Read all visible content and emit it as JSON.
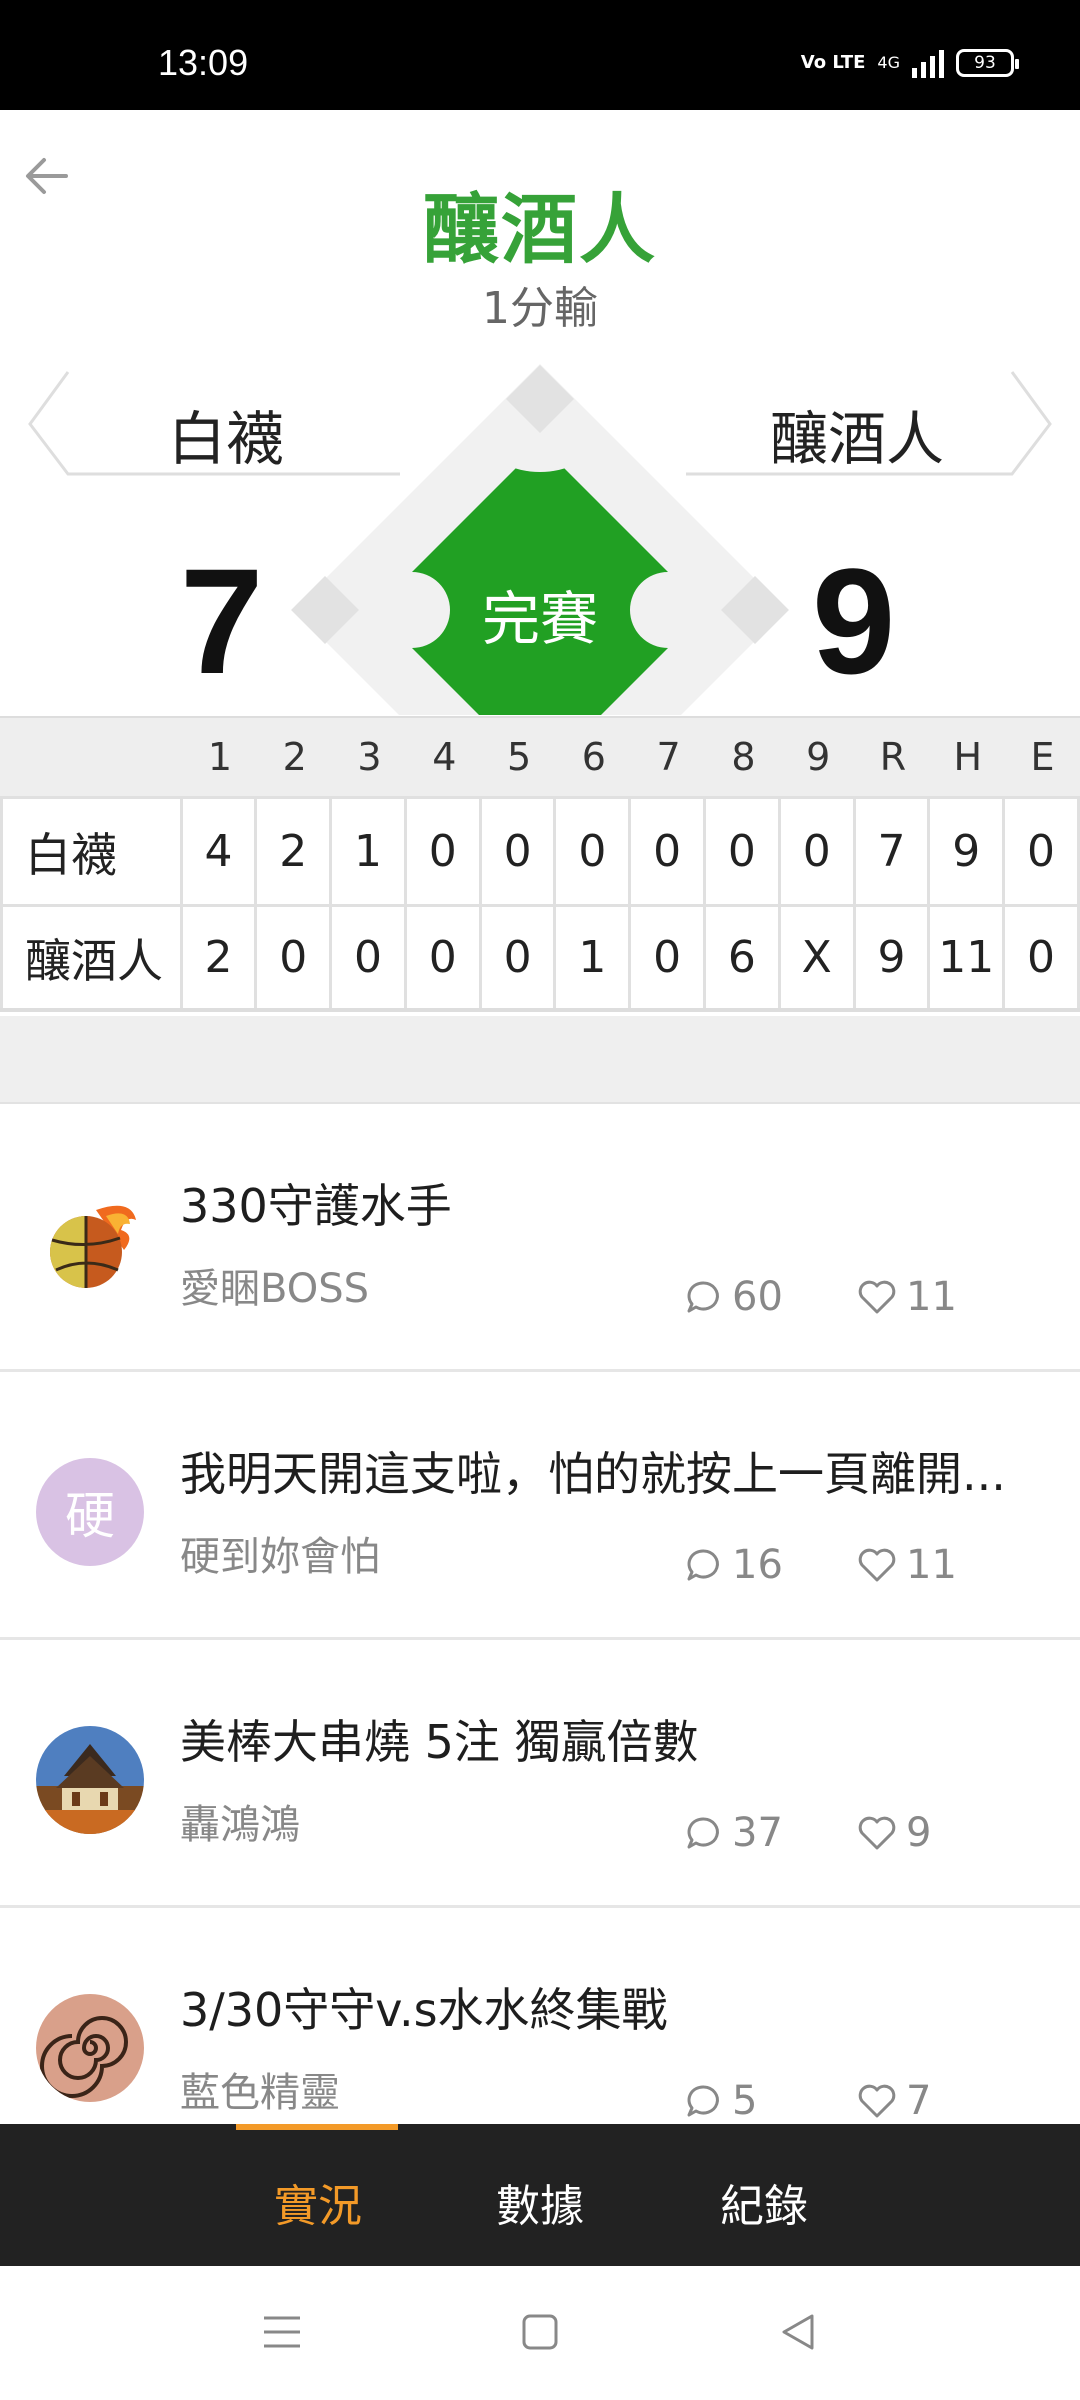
{
  "status_bar": {
    "time": "13:09",
    "network": "4G",
    "volte": "Vo LTE",
    "battery": "93"
  },
  "header": {
    "title": "釀酒人",
    "result": "1分輸"
  },
  "matchup": {
    "away_team": "白襪",
    "home_team": "釀酒人",
    "away_score": "7",
    "home_score": "9",
    "status": "完賽"
  },
  "linescore": {
    "columns": [
      "1",
      "2",
      "3",
      "4",
      "5",
      "6",
      "7",
      "8",
      "9",
      "R",
      "H",
      "E"
    ],
    "rows": [
      {
        "team": "白襪",
        "cells": [
          "4",
          "2",
          "1",
          "0",
          "0",
          "0",
          "0",
          "0",
          "0",
          "7",
          "9",
          "0"
        ]
      },
      {
        "team": "釀酒人",
        "cells": [
          "2",
          "0",
          "0",
          "0",
          "0",
          "1",
          "0",
          "6",
          "X",
          "9",
          "11",
          "0"
        ]
      }
    ]
  },
  "posts": [
    {
      "title": "330守護水手",
      "author": "愛睏BOSS",
      "comments": "60",
      "likes": "11",
      "avatar": "fireball-ball-icon"
    },
    {
      "title": "我明天開這支啦，怕的就按上一頁離開...",
      "author": "硬到妳會怕",
      "comments": "16",
      "likes": "11",
      "avatar_text": "硬"
    },
    {
      "title": "美棒大串燒 5注 獨贏倍數",
      "author": "轟鴻鴻",
      "comments": "37",
      "likes": "9",
      "avatar": "temple-photo-icon"
    },
    {
      "title": "3/30守守v.s水水終集戰",
      "author": "藍色精靈",
      "comments": "5",
      "likes": "7",
      "avatar": "spiral-pattern-icon"
    }
  ],
  "tabs": [
    {
      "label": "實況",
      "active": true
    },
    {
      "label": "數據",
      "active": false
    },
    {
      "label": "紀錄",
      "active": false
    }
  ],
  "colors": {
    "brand_green": "#36a238",
    "diamond_green": "#21a023",
    "tab_active": "#f39a28",
    "tab_bar": "#222222"
  },
  "nav": {
    "icons": [
      "menu-icon",
      "home-square-icon",
      "back-triangle-icon"
    ]
  }
}
